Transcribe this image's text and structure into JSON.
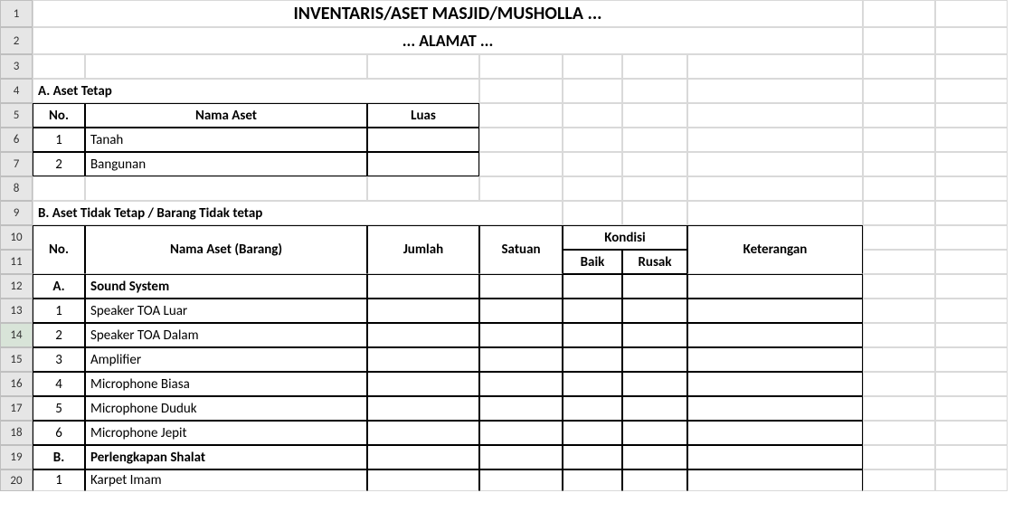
{
  "rows": [
    "1",
    "2",
    "3",
    "4",
    "5",
    "6",
    "7",
    "8",
    "9",
    "10",
    "11",
    "12",
    "13",
    "14",
    "15",
    "16",
    "17",
    "18",
    "19",
    "20"
  ],
  "title": "INVENTARIS/ASET MASJID/MUSHOLLA ...",
  "subtitle": "... ALAMAT ...",
  "sectionA": {
    "heading": "A. Aset Tetap",
    "headers": {
      "no": "No.",
      "nama": "Nama Aset",
      "luas": "Luas"
    },
    "items": [
      {
        "no": "1",
        "nama": "Tanah",
        "luas": ""
      },
      {
        "no": "2",
        "nama": "Bangunan",
        "luas": ""
      }
    ]
  },
  "sectionB": {
    "heading": "B. Aset Tidak Tetap / Barang Tidak tetap",
    "headers": {
      "no": "No.",
      "nama": "Nama Aset (Barang)",
      "jumlah": "Jumlah",
      "satuan": "Satuan",
      "kondisi": "Kondisi",
      "baik": "Baik",
      "rusak": "Rusak",
      "keterangan": "Keterangan"
    },
    "items": [
      {
        "no": "A.",
        "nama": "Sound System",
        "bold": true
      },
      {
        "no": "1",
        "nama": "Speaker TOA Luar"
      },
      {
        "no": "2",
        "nama": "Speaker TOA Dalam"
      },
      {
        "no": "3",
        "nama": "Amplifier"
      },
      {
        "no": "4",
        "nama": "Microphone Biasa"
      },
      {
        "no": "5",
        "nama": "Microphone Duduk"
      },
      {
        "no": "6",
        "nama": "Microphone Jepit"
      },
      {
        "no": "B.",
        "nama": "Perlengkapan Shalat",
        "bold": true
      },
      {
        "no": "1",
        "nama": "Karpet Imam"
      }
    ]
  }
}
